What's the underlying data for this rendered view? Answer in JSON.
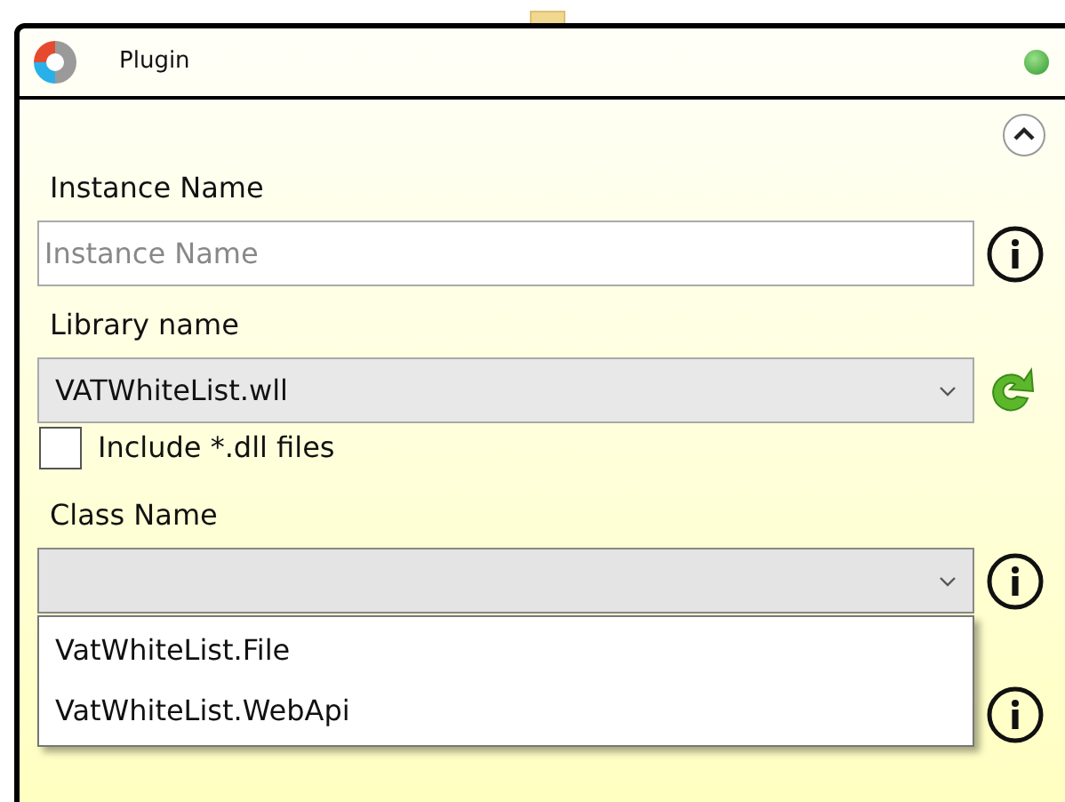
{
  "window": {
    "title": "Plugin"
  },
  "fields": {
    "instance_name": {
      "label": "Instance Name",
      "placeholder": "Instance Name"
    },
    "library_name": {
      "label": "Library name",
      "value": "VATWhiteList.wll"
    },
    "include_dll": {
      "label": "Include *.dll files",
      "checked": false
    },
    "class_name": {
      "label": "Class Name",
      "expanded": true,
      "options": [
        {
          "label": "VatWhiteList.File",
          "selected": false
        },
        {
          "label": "VatWhiteList.WebApi",
          "selected": false
        }
      ]
    }
  }
}
